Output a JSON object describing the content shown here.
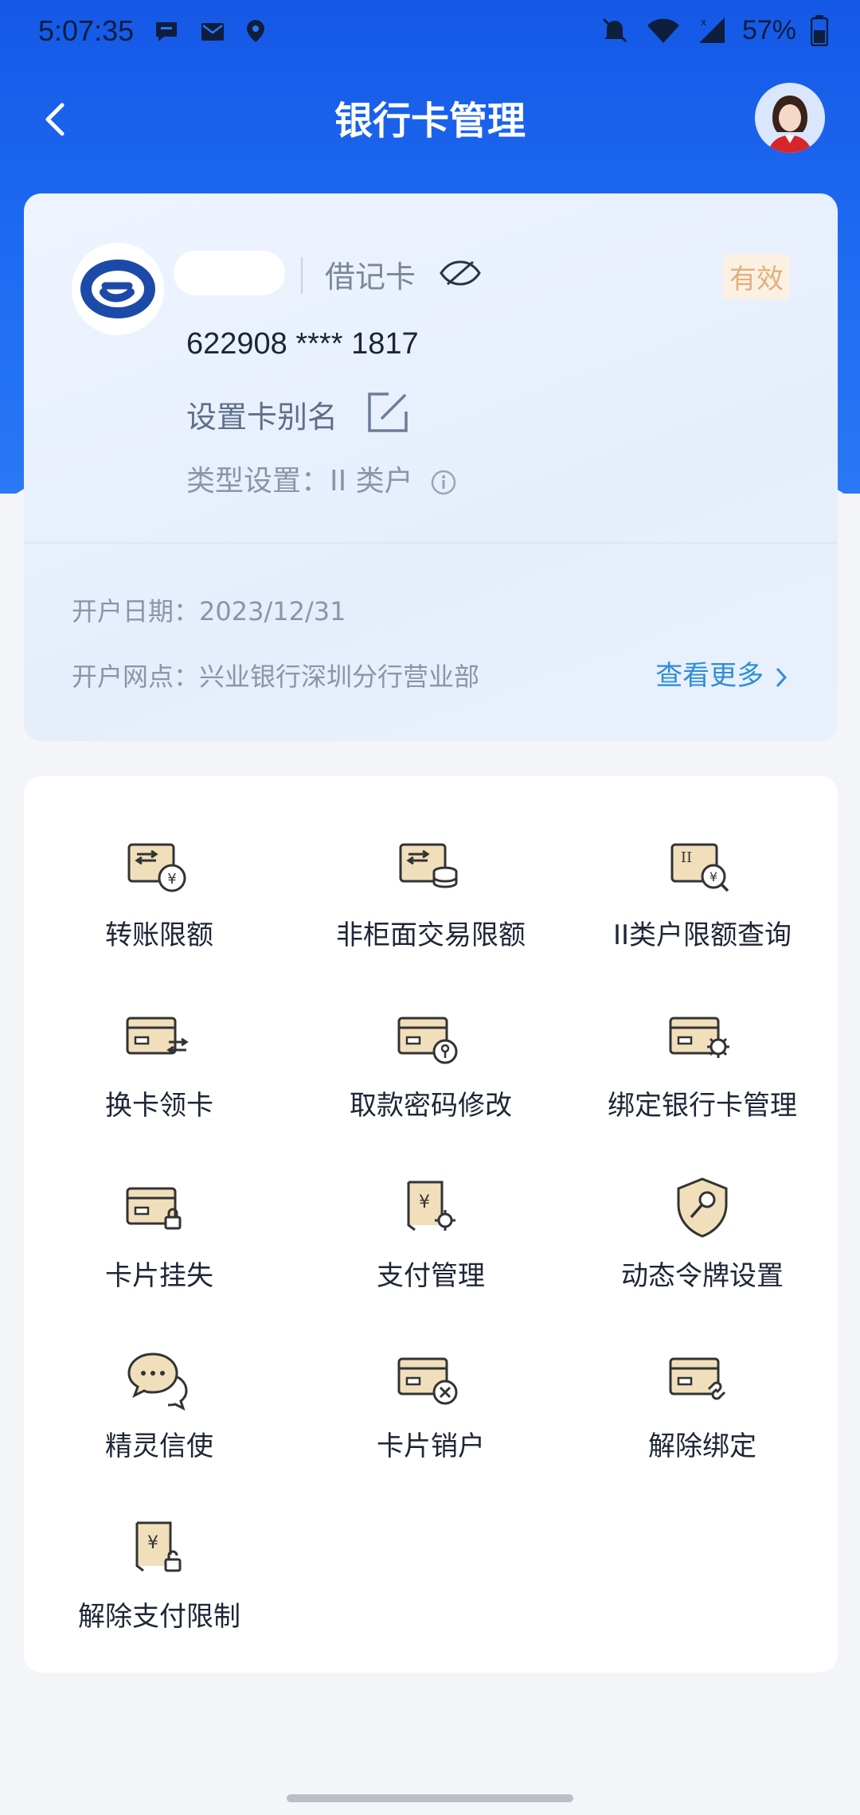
{
  "status_bar": {
    "time": "5:07:35",
    "battery": "57%"
  },
  "header": {
    "title": "银行卡管理"
  },
  "card": {
    "card_type": "借记卡",
    "status_badge": "有效",
    "card_number": "622908 **** 1817",
    "alias_label": "设置卡别名",
    "type_setting": "类型设置：II 类户",
    "open_date": "开户日期：2023/12/31",
    "open_branch": "开户网点：兴业银行深圳分行营业部",
    "view_more": "查看更多"
  },
  "services": [
    {
      "label": "转账限额",
      "icon": "transfer-limit-icon"
    },
    {
      "label": "非柜面交易限额",
      "icon": "non-counter-limit-icon"
    },
    {
      "label": "II类户限额查询",
      "icon": "class2-limit-query-icon"
    },
    {
      "label": "换卡领卡",
      "icon": "card-exchange-icon"
    },
    {
      "label": "取款密码修改",
      "icon": "withdraw-password-icon"
    },
    {
      "label": "绑定银行卡管理",
      "icon": "bound-card-settings-icon"
    },
    {
      "label": "卡片挂失",
      "icon": "card-lock-icon"
    },
    {
      "label": "支付管理",
      "icon": "payment-settings-icon"
    },
    {
      "label": "动态令牌设置",
      "icon": "token-shield-icon"
    },
    {
      "label": "精灵信使",
      "icon": "chat-bubble-icon"
    },
    {
      "label": "卡片销户",
      "icon": "card-close-icon"
    },
    {
      "label": "解除绑定",
      "icon": "unlink-card-icon"
    },
    {
      "label": "解除支付限制",
      "icon": "payment-unlock-icon"
    }
  ],
  "colors": {
    "primary": "#1f6cf2",
    "accent_gold": "#e2b07a",
    "link": "#2f8ed8"
  }
}
